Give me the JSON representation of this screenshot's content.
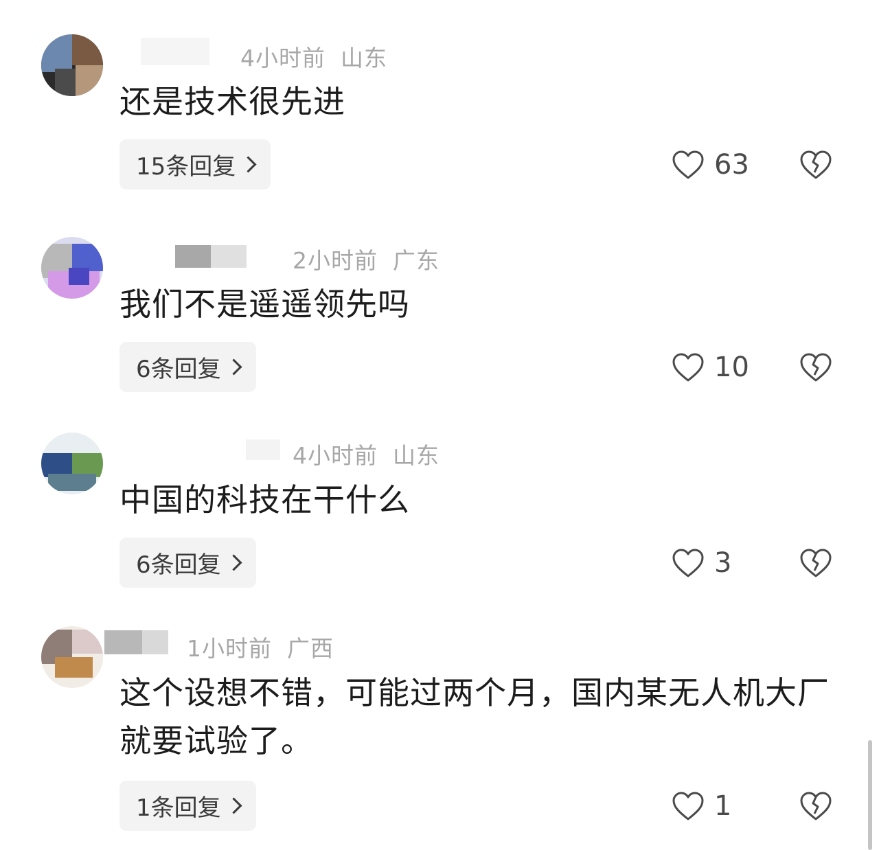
{
  "comments": [
    {
      "time": "4小时前",
      "location": "山东",
      "text": "还是技术很先进",
      "reply_label": "15条回复",
      "likes": "63"
    },
    {
      "time": "2小时前",
      "location": "广东",
      "text": "我们不是遥遥领先吗",
      "reply_label": "6条回复",
      "likes": "10"
    },
    {
      "time": "4小时前",
      "location": "山东",
      "text": "中国的科技在干什么",
      "reply_label": "6条回复",
      "likes": "3"
    },
    {
      "time": "1小时前",
      "location": "广西",
      "text": "这个设想不错，可能过两个月，国内某无人机大厂就要试验了。",
      "reply_label": "1条回复",
      "likes": "1"
    }
  ],
  "icons": {
    "like": "heart-outline-icon",
    "dislike": "broken-heart-icon"
  },
  "colors": {
    "meta_text": "#a7a7a7",
    "reply_bg": "#f3f3f3",
    "body_text": "#1c1c1c"
  }
}
